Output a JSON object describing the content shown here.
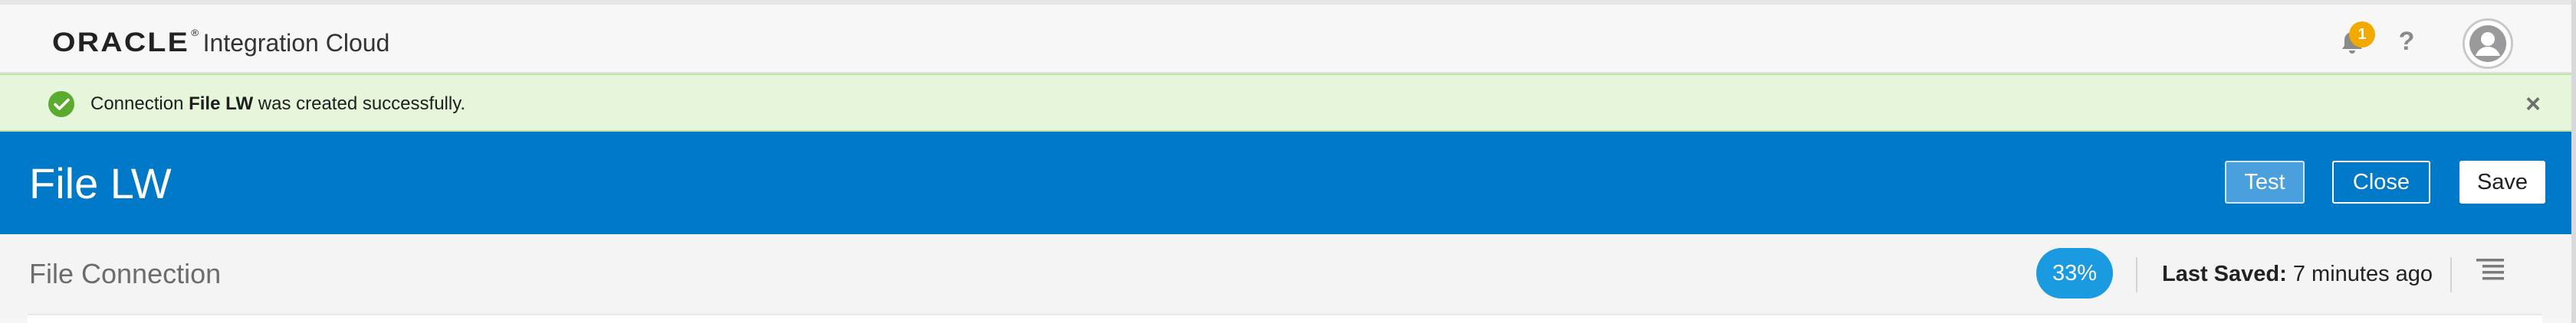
{
  "topbar": {
    "brand_logo": "ORACLE",
    "brand_logo_mark": "®",
    "brand_product": "Integration Cloud",
    "notifications_count": "1",
    "help_symbol": "?"
  },
  "notice": {
    "text_before": "Connection ",
    "text_bold": "File LW",
    "text_after": " was created successfully.",
    "close_symbol": "×"
  },
  "header": {
    "title": "File LW",
    "test_label": "Test",
    "close_label": "Close",
    "save_label": "Save"
  },
  "subbar": {
    "title": "File Connection",
    "progress": "33%",
    "last_saved_label": "Last Saved:",
    "last_saved_value": " 7 minutes ago"
  },
  "colors": {
    "header_blue": "#0079c8",
    "notice_green": "#e6f6da",
    "success_icon": "#5aab2e",
    "badge_orange": "#f2a900",
    "progress_blue": "#1a9ae0"
  },
  "icons": {
    "bell": "bell-icon",
    "help": "help-icon",
    "avatar": "user-avatar-icon",
    "success": "check-circle-icon",
    "close": "close-icon",
    "menu": "list-menu-icon"
  }
}
